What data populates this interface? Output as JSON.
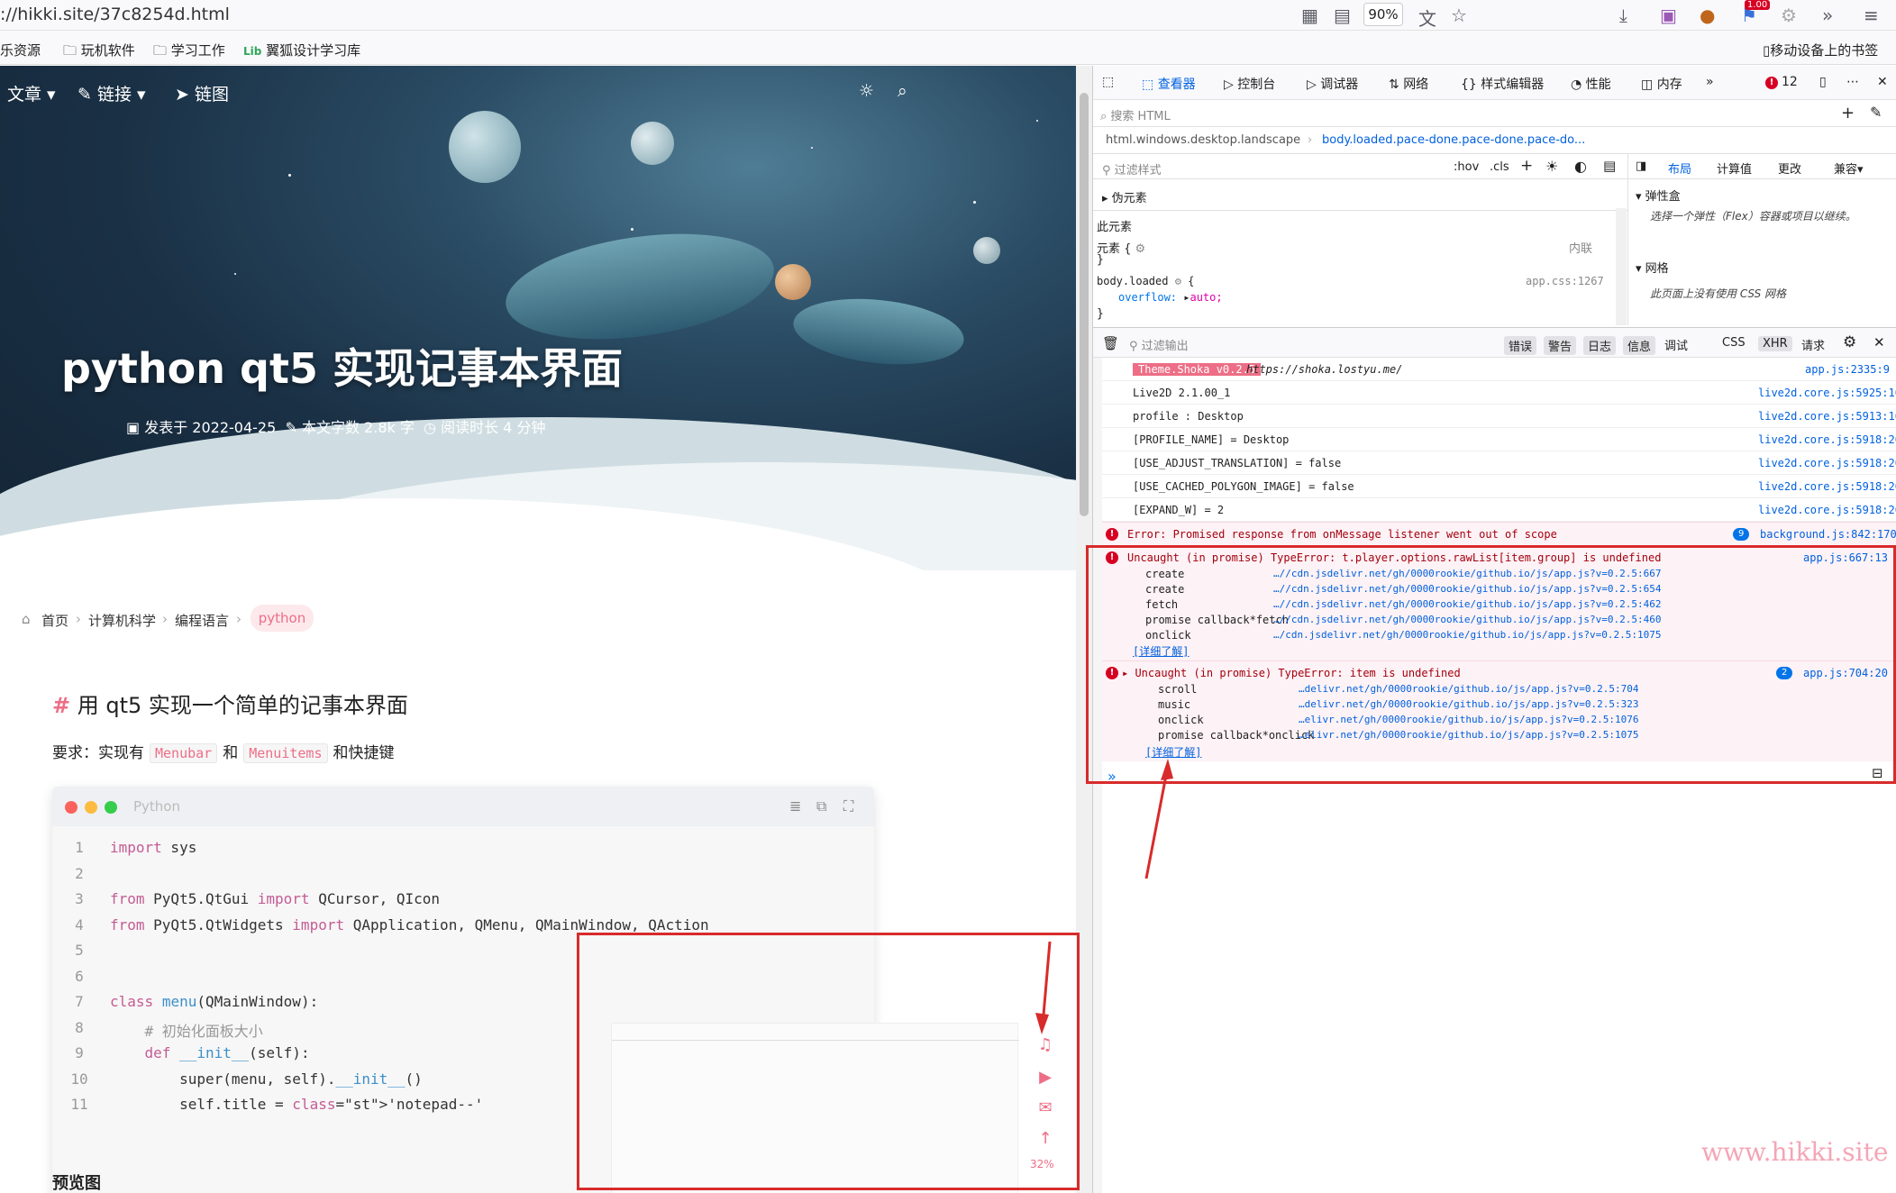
{
  "browser": {
    "url": "://hikki.site/37c8254d.html",
    "zoom": "90%",
    "badge": "1.00",
    "bookmarks": [
      "乐资源",
      "玩机软件",
      "学习工作",
      "翼狐设计学习库"
    ],
    "mobile_bookmarks": "移动设备上的书签"
  },
  "page": {
    "nav": {
      "articles": "文章",
      "links": "链接",
      "linkmap": "链图"
    },
    "title": "python qt5 实现记事本界面",
    "meta": {
      "posted": "发表于 2022-04-25",
      "words": "本文字数 2.8k 字",
      "read": "阅读时长 4 分钟"
    },
    "breadcrumb": [
      "首页",
      "计算机科学",
      "编程语言"
    ],
    "tag": "python",
    "heading_hash": "#",
    "heading": "用 qt5 实现一个简单的记事本界面",
    "req_prefix": "要求：实现有",
    "req_code1": "Menubar",
    "req_and": "和",
    "req_code2": "Menuitems",
    "req_suffix": "和快捷键",
    "code_lang": "Python",
    "code_lines": [
      {
        "n": "1",
        "t": "import sys"
      },
      {
        "n": "2",
        "t": ""
      },
      {
        "n": "3",
        "t": "from PyQt5.QtGui import QCursor, QIcon"
      },
      {
        "n": "4",
        "t": "from PyQt5.QtWidgets import QApplication, QMenu, QMainWindow, QAction"
      },
      {
        "n": "5",
        "t": ""
      },
      {
        "n": "6",
        "t": ""
      },
      {
        "n": "7",
        "t": "class menu(QMainWindow):"
      },
      {
        "n": "8",
        "t": "    # 初始化面板大小"
      },
      {
        "n": "9",
        "t": "    def __init__(self):"
      },
      {
        "n": "10",
        "t": "        super(menu, self).__init__()"
      },
      {
        "n": "11",
        "t": "        self.title = 'notepad--'"
      }
    ],
    "preview": "预览图",
    "scroll_percent": "32%",
    "watermark": "www.hikki.site"
  },
  "devtools": {
    "tabs": [
      "查看器",
      "控制台",
      "调试器",
      "网络",
      "样式编辑器",
      "性能",
      "内存"
    ],
    "error_count": "12",
    "search_html": "搜索 HTML",
    "breadcrumb1": "html.windows.desktop.landscape",
    "breadcrumb2": "body.loaded.pace-done.pace-done.pace-do...",
    "filter_styles": "过滤样式",
    "hov": ":hov",
    "cls": ".cls",
    "layout_tabs": [
      "布局",
      "计算值",
      "更改",
      "兼容"
    ],
    "pseudo": "伪元素",
    "this_element": "此元素",
    "element_rule": "元素 {",
    "inline": "内联",
    "rule_close": "}",
    "body_rule": "body.loaded",
    "body_src": "app.css:1267",
    "overflow_prop": "overflow:",
    "overflow_val": "auto;",
    "flex_title": "弹性盒",
    "flex_hint": "选择一个弹性（Flex）容器或项目以继续。",
    "grid_title": "网格",
    "grid_hint": "此页面上没有使用 CSS 网格",
    "filter_output": "过滤输出",
    "console_filters": [
      "错误",
      "警告",
      "日志",
      "信息",
      "调试",
      "CSS",
      "XHR",
      "请求"
    ],
    "logs": [
      {
        "text": "Theme.Shoka v0.2.5",
        "url": "https://shoka.lostyu.me/",
        "src": "app.js:2335:9"
      },
      {
        "text": "Live2D 2.1.00_1",
        "src": "live2d.core.js:5925:16"
      },
      {
        "text": "profile : Desktop",
        "src": "live2d.core.js:5913:16"
      },
      {
        "text": "  [PROFILE_NAME] = Desktop",
        "src": "live2d.core.js:5918:20"
      },
      {
        "text": "  [USE_ADJUST_TRANSLATION] = false",
        "src": "live2d.core.js:5918:20"
      },
      {
        "text": "  [USE_CACHED_POLYGON_IMAGE] = false",
        "src": "live2d.core.js:5918:20"
      },
      {
        "text": "  [EXPAND_W] = 2",
        "src": "live2d.core.js:5918:20"
      }
    ],
    "err1": {
      "text": "Error: Promised response from onMessage listener went out of scope",
      "count": "9",
      "src": "background.js:842:170"
    },
    "err2": {
      "text": "Uncaught (in promise) TypeError: t.player.options.rawList[item.group] is undefined",
      "src": "app.js:667:13",
      "stack": [
        {
          "fn": "create",
          "loc": "…//cdn.jsdelivr.net/gh/0000rookie/github.io/js/app.js?v=0.2.5:667"
        },
        {
          "fn": "create",
          "loc": "…//cdn.jsdelivr.net/gh/0000rookie/github.io/js/app.js?v=0.2.5:654"
        },
        {
          "fn": "fetch",
          "loc": "…//cdn.jsdelivr.net/gh/0000rookie/github.io/js/app.js?v=0.2.5:462"
        },
        {
          "fn": "promise callback*fetch",
          "loc": "…//cdn.jsdelivr.net/gh/0000rookie/github.io/js/app.js?v=0.2.5:460"
        },
        {
          "fn": "onclick",
          "loc": "…/cdn.jsdelivr.net/gh/0000rookie/github.io/js/app.js?v=0.2.5:1075"
        }
      ],
      "more": "[详细了解]"
    },
    "err3": {
      "text": "Uncaught (in promise) TypeError: item is undefined",
      "count": "2",
      "src": "app.js:704:20",
      "stack": [
        {
          "fn": "scroll",
          "loc": "…delivr.net/gh/0000rookie/github.io/js/app.js?v=0.2.5:704"
        },
        {
          "fn": "music",
          "loc": "…delivr.net/gh/0000rookie/github.io/js/app.js?v=0.2.5:323"
        },
        {
          "fn": "onclick",
          "loc": "…elivr.net/gh/0000rookie/github.io/js/app.js?v=0.2.5:1076"
        },
        {
          "fn": "promise callback*onclick",
          "loc": "…elivr.net/gh/0000rookie/github.io/js/app.js?v=0.2.5:1075"
        }
      ],
      "more": "[详细了解]"
    },
    "prompt": "»"
  }
}
